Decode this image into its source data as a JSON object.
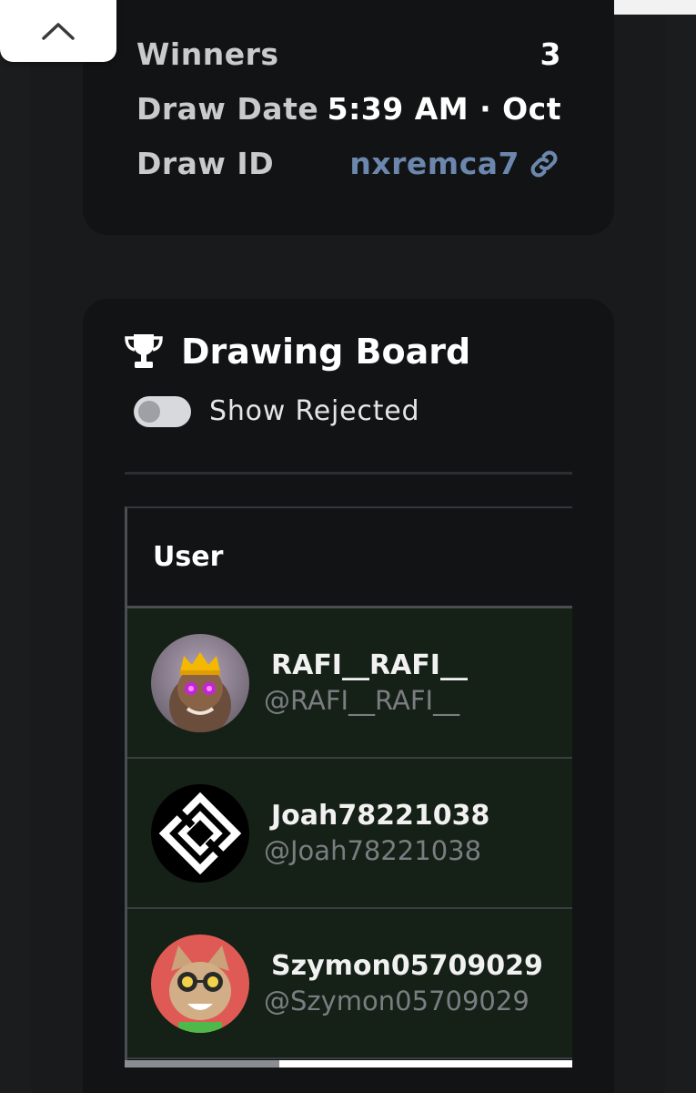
{
  "info": {
    "winners_label": "Winners",
    "winners_value": "3",
    "draw_date_label": "Draw Date",
    "draw_date_value": "5:39 AM · Oct",
    "draw_id_label": "Draw ID",
    "draw_id_value": "nxremca7"
  },
  "board": {
    "title": "Drawing Board",
    "toggle_label": "Show Rejected",
    "toggle_on": false
  },
  "table": {
    "column_user": "User",
    "rows": [
      {
        "name": "RAFI__RAFI__",
        "handle": "@RAFI__RAFI__",
        "avatar": "crown-avatar"
      },
      {
        "name": "Joah78221038",
        "handle": "@Joah78221038",
        "avatar": "geometric-logo-avatar"
      },
      {
        "name": "Szymon05709029",
        "handle": "@Szymon05709029",
        "avatar": "cat-avatar"
      }
    ]
  },
  "colors": {
    "card_bg": "#121314",
    "row_bg": "#152016",
    "link": "#6c87ad",
    "handle": "#7a7d82"
  }
}
